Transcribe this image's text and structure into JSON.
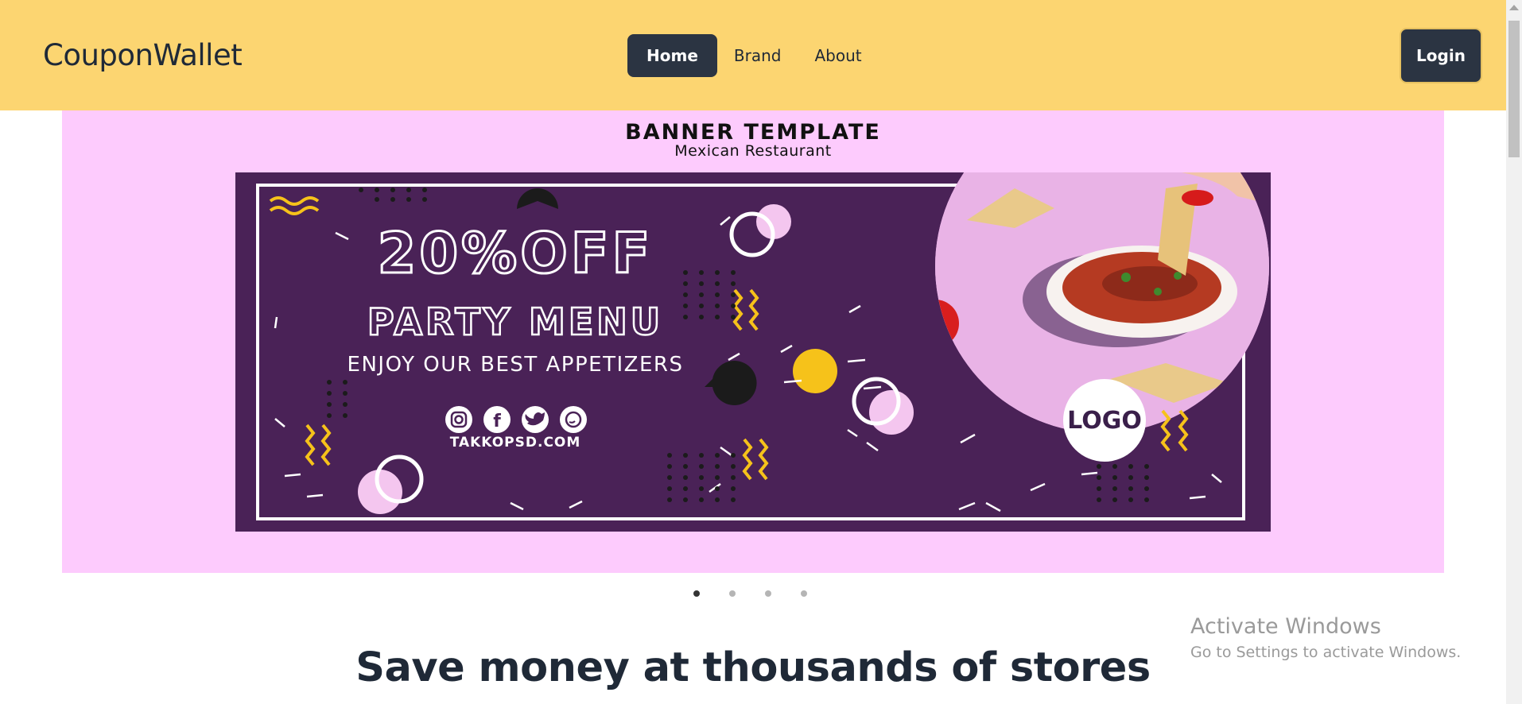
{
  "navbar": {
    "brand": "CouponWallet",
    "links": [
      {
        "label": "Home",
        "active": true
      },
      {
        "label": "Brand",
        "active": false
      },
      {
        "label": "About",
        "active": false
      }
    ],
    "login_label": "Login",
    "background": "#fcd571"
  },
  "carousel": {
    "background": "#fdcbfd",
    "slide": {
      "title": "BANNER TEMPLATE",
      "subtitle": "Mexican Restaurant",
      "discount": "20%OFF",
      "menu": "PARTY MENU",
      "tagline": "ENJOY OUR BEST APPETIZERS",
      "social_icons": [
        "instagram-icon",
        "facebook-icon",
        "twitter-icon",
        "whatsapp-icon"
      ],
      "website": "TAKKOPSD.COM",
      "logo_text": "LOGO",
      "banner_color": "#4a2257"
    },
    "indicators": 4,
    "active_index": 0
  },
  "main": {
    "headline": "Save money at thousands of stores"
  },
  "watermark": {
    "title": "Activate Windows",
    "subtitle": "Go to Settings to activate Windows."
  }
}
